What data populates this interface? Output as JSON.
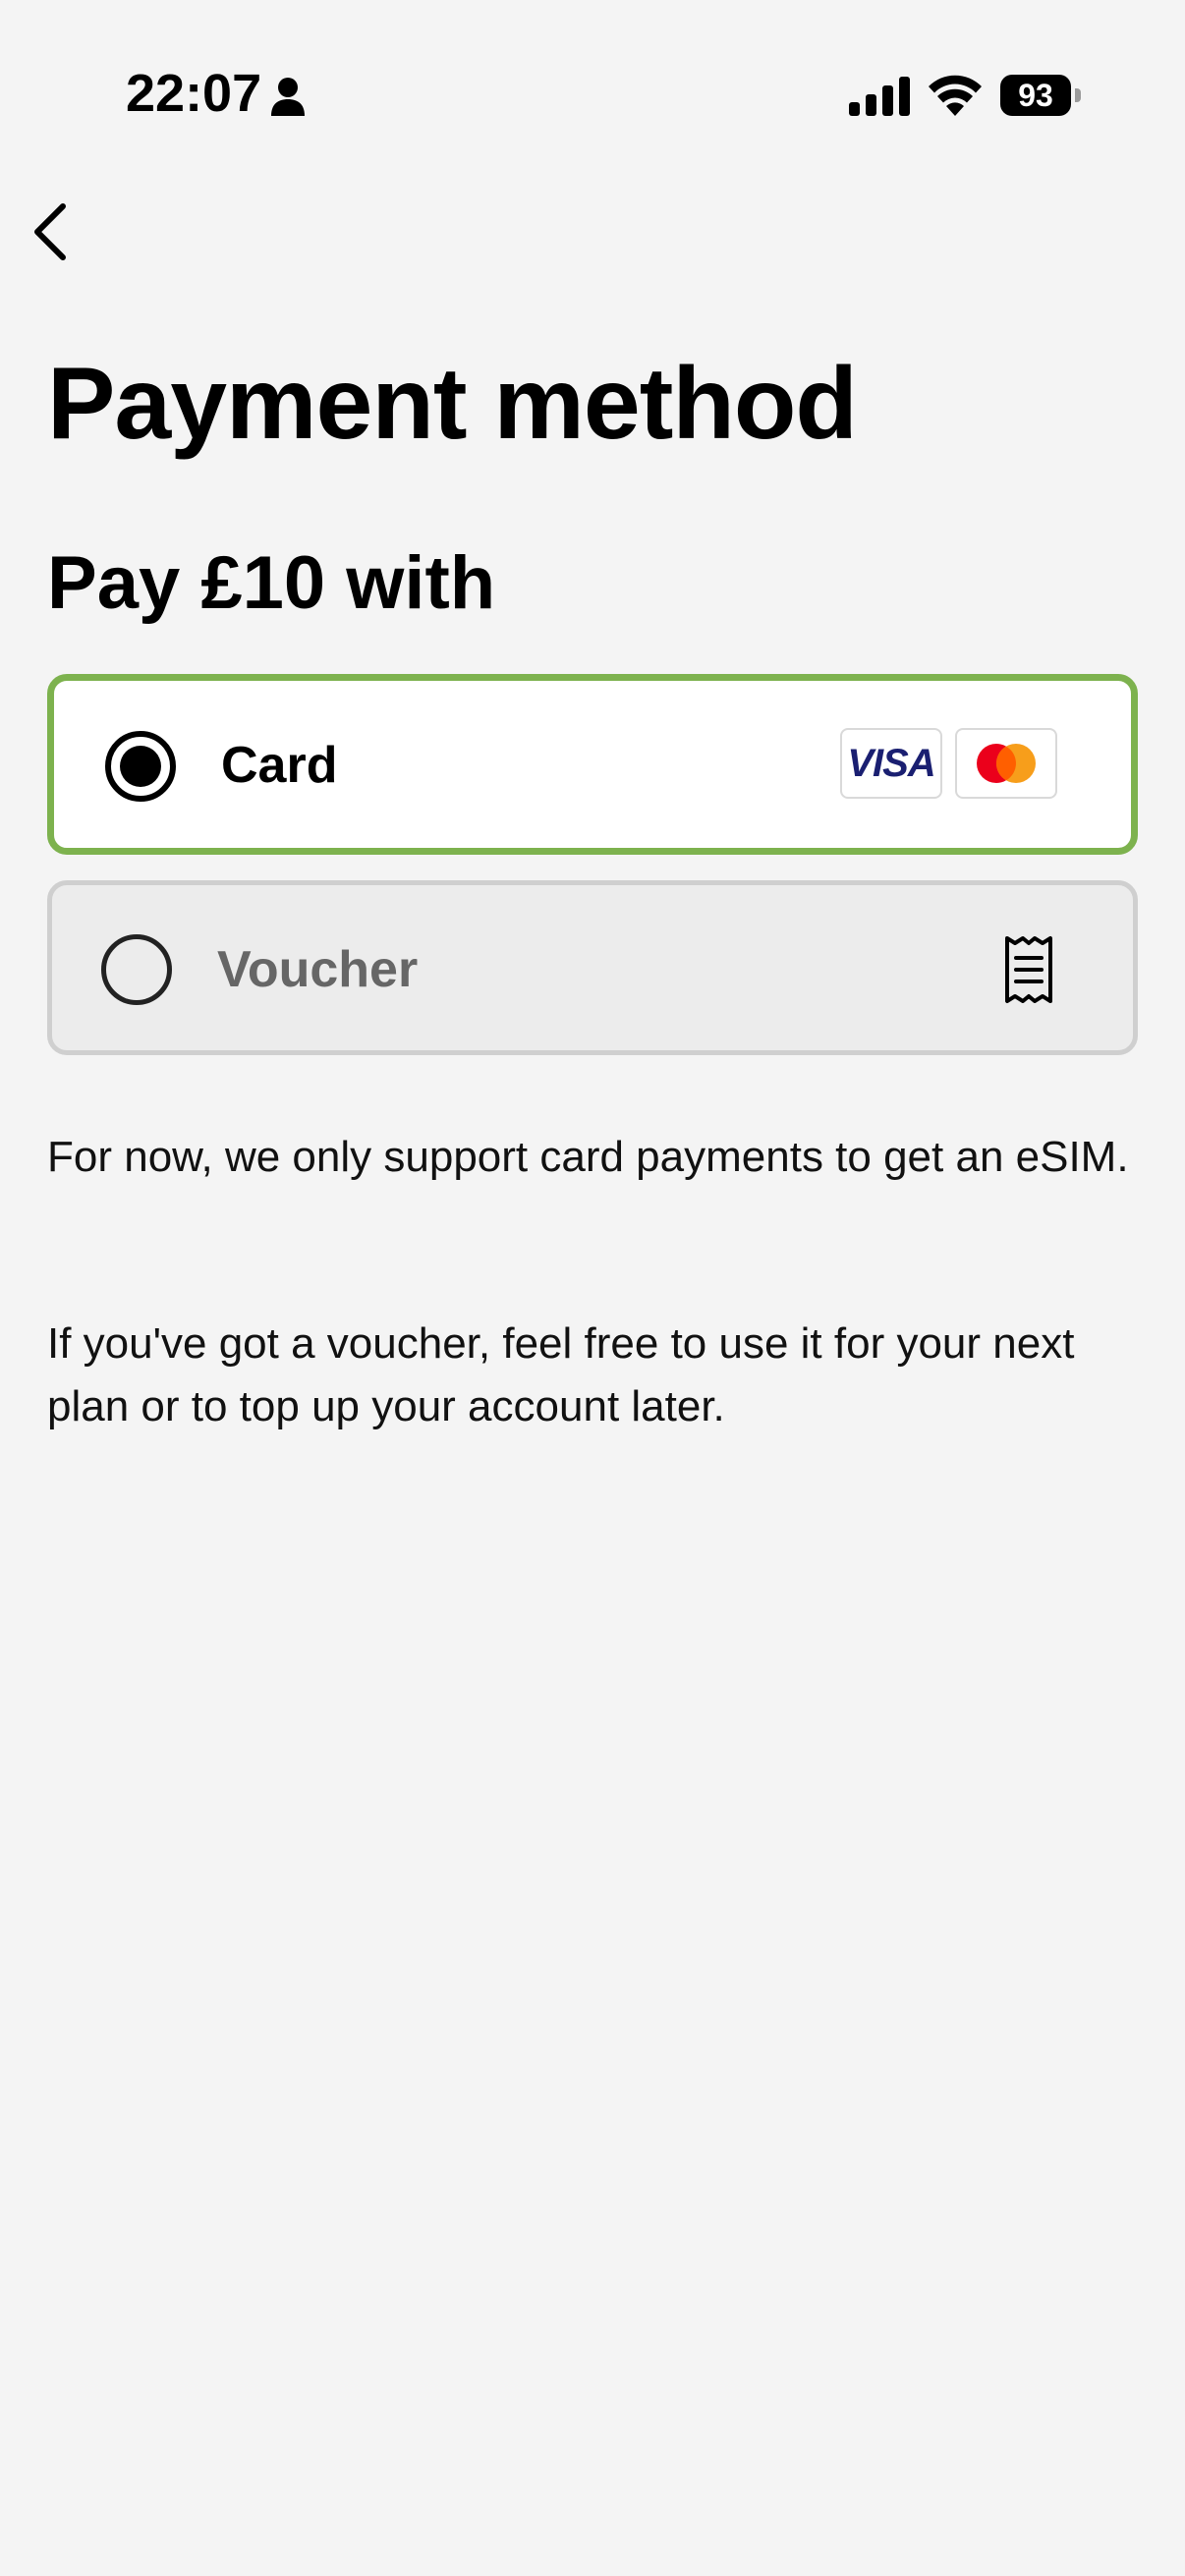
{
  "status_bar": {
    "time": "22:07",
    "battery_level": "93",
    "icons": [
      "person-icon",
      "signal-icon",
      "wifi-icon",
      "battery-icon"
    ]
  },
  "header": {
    "back_icon": "chevron-left-icon",
    "title": "Payment method"
  },
  "payment": {
    "heading": "Pay £10 with",
    "options": [
      {
        "label": "Card",
        "selected": true,
        "brands": [
          "VISA",
          "mastercard"
        ],
        "accent_color": "#7db24e"
      },
      {
        "label": "Voucher",
        "selected": false,
        "icon": "receipt-icon"
      }
    ]
  },
  "info": {
    "line1": "For now, we only support card payments to get an eSIM.",
    "line2": "If you've got a voucher, feel free to use it for your next plan or to top up your account later."
  },
  "colors": {
    "background": "#f4f4f4",
    "selected_border": "#7db24e",
    "visa_blue": "#1a1f71",
    "mastercard_red": "#eb001b",
    "mastercard_orange": "#f79e1b"
  }
}
